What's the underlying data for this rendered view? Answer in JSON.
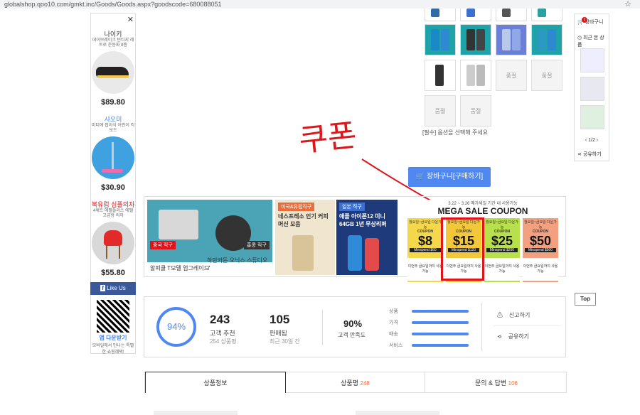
{
  "browser": {
    "url": "globalshop.qoo10.com/gmkt.inc/Goods/Goods.aspx?goodscode=680088051"
  },
  "left_ads": {
    "products": [
      {
        "brand": "나이키",
        "desc": "데이브레이크 빈티지 레트로 운동화 8종",
        "price": "$89.80"
      },
      {
        "brand": "샤오미",
        "desc": "미티에 접이식 어린이 킥보드",
        "price": "$30.90"
      },
      {
        "brand": "북유럽 심플의자",
        "desc": "4세트 에펠플라스 에펠 고급형 의자",
        "price": "$55.80"
      }
    ],
    "like_us": "Like Us",
    "app_title": "앱 다운받기",
    "app_desc": "모바일에서 만나는 특별한 쇼핑혜택!"
  },
  "options": {
    "sold_out_label": "품절",
    "hint": "[필수] 옵션을 선택해 주세요"
  },
  "annotation": "쿠폰",
  "cart_button": "장바구니[구매하기]",
  "banners": [
    {
      "tag": "중국 직구",
      "title": "알피쿨 T모델 업그레이드"
    },
    {
      "tag": "",
      "title": "하만카돈 오닉스 스튜디오 7",
      "tag2": "홍콩 직구"
    },
    {
      "tag": "미국&유럽직구",
      "title": "네스프레소 인기 커피머신 모음"
    },
    {
      "tag": "일본 직구",
      "title": "애플 아이폰12 미니 64GB 1년 무상리퍼"
    }
  ],
  "coupon_banner": {
    "period": "3.22 ~ 3.26 메가세일 기간 내 사용가능",
    "title": "MEGA SALE COUPON",
    "coupons": [
      {
        "amount": "$8",
        "min": "Minspend $60"
      },
      {
        "amount": "$15",
        "min": "Minspend $120"
      },
      {
        "amount": "$25",
        "min": "Minspend $200"
      },
      {
        "amount": "$50",
        "min": "Minspend $500"
      }
    ],
    "header": "월요일~금요일 다운가능",
    "label": "COUPON",
    "footer": "이번주 금요일까지 사용가능"
  },
  "stats": {
    "rate": "94%",
    "recommend_num": "243",
    "recommend_label": "고객 추천",
    "recommend_sub": "254 상품평",
    "sold_num": "105",
    "sold_label": "판매됨",
    "sold_sub": "최근 30일 간",
    "satisfaction": "90%",
    "satisfaction_label": "고객 만족도",
    "bars": [
      {
        "label": "상품",
        "value": 0.95
      },
      {
        "label": "가격",
        "value": 0.95
      },
      {
        "label": "배송",
        "value": 0.95
      },
      {
        "label": "서비스",
        "value": 0.95
      }
    ],
    "report": "신고하기",
    "share": "공유하기"
  },
  "top_button": "Top",
  "right_col": {
    "cart": "장바구니",
    "cart_count": "1",
    "recent": "최근 본 상품",
    "page": "1/2",
    "share": "공유하기"
  },
  "tabs": [
    {
      "label": "상품정보",
      "count": ""
    },
    {
      "label": "상품평",
      "count": "248"
    },
    {
      "label": "문의 & 답변",
      "count": "106"
    }
  ],
  "colors": {
    "accent": "#4f88f0",
    "highlight": "#e0151b"
  }
}
